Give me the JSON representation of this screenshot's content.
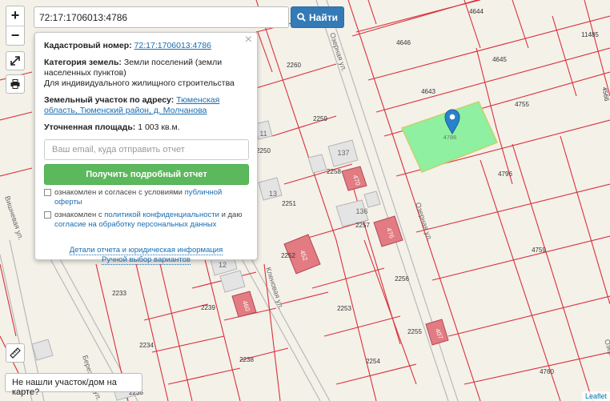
{
  "search": {
    "value": "72:17:1706013:4786",
    "button_label": "Найти"
  },
  "zoom": {
    "in": "+",
    "out": "−"
  },
  "popup": {
    "cad_label": "Кадастровый номер:",
    "cad_value": "72:17:1706013:4786",
    "cat_label": "Категория земель:",
    "cat_value": "Земли поселений (земли населенных пунктов)",
    "use_value": "Для индивидуального жилищного строительства",
    "addr_label": "Земельный участок по адресу:",
    "addr_value": "Тюменская область, Тюменский район, д. Молчанова",
    "area_label": "Уточненная площадь:",
    "area_value": "1 003 кв.м.",
    "email_placeholder": "Ваш email, куда отправить отчет",
    "report_button": "Получить подробный отчет",
    "agree1_text": "ознакомлен и согласен с условиями",
    "agree1_link": "публичной оферты",
    "agree2_text1": "ознакомлен с",
    "agree2_link1": "политикой конфиденциальности",
    "agree2_text2": "и даю",
    "agree2_link2": "согласие на обработку персональных данных",
    "details_link": "Детали отчета и юридическая информация",
    "manual_link": "Ручной выбор вариантов"
  },
  "not_found": "Не нашли участок/дом на карте?",
  "attribution": "Leaflet",
  "map": {
    "highlight_color": "#8ef0a0",
    "parcel_line_color": "#d9303a",
    "building_color": "#e27b82",
    "selected_parcel": "4786",
    "parcel_labels": [
      "4644",
      "11485",
      "4646",
      "4645",
      "4643",
      "4755",
      "4796",
      "4759",
      "4760",
      "2260",
      "2259",
      "2258",
      "2251",
      "2257",
      "2252",
      "2256",
      "2253",
      "2255",
      "2254",
      "2233",
      "2239",
      "2234",
      "2238",
      "2235",
      "2250",
      "4566"
    ],
    "building_labels": [
      "137",
      "136",
      "11",
      "13",
      "12",
      "470",
      "47б",
      "452",
      "460",
      "407"
    ],
    "street_labels": [
      "Озерная ул.",
      "Озерная ул.",
      "Кленовая ул.",
      "Вишневая ул.",
      "Березовая ул.",
      "Озерная ул."
    ]
  }
}
